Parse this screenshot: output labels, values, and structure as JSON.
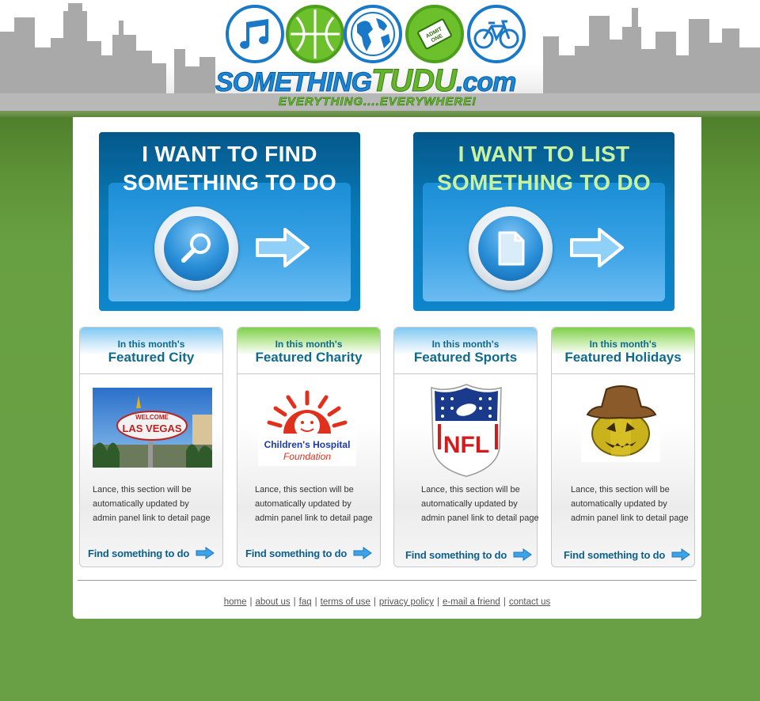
{
  "site": {
    "logo_part1": "SOMETHING",
    "logo_part2": "TUDU",
    "logo_part3": ".com",
    "tagline": "EVERYTHING....EVERYWHERE!"
  },
  "header_icons": [
    "music-icon",
    "basketball-icon",
    "globe-icon",
    "ticket-icon",
    "bicycle-icon"
  ],
  "find_panel": {
    "line1": "I WANT TO FIND",
    "line2": "SOMETHING TO DO",
    "icon": "magnifier-icon"
  },
  "list_panel": {
    "line1": "I WANT TO LIST",
    "line2": "SOMETHING TO DO",
    "icon": "document-icon"
  },
  "featured": [
    {
      "small": "In this month's",
      "title": "Featured City",
      "desc": "Lance, this section will be automatically updated by admin panel link to detail page",
      "link": "Find something to do",
      "image": "Las Vegas welcome sign",
      "image_text": "LAS VEGAS"
    },
    {
      "small": "In this month's",
      "title": "Featured Charity",
      "desc": "Lance, this section will be automatically updated by admin panel link to detail page",
      "link": "Find something to do",
      "image": "BC Children's Hospital Foundation logo",
      "image_text": "Children's Hospital",
      "image_subtext": "Foundation"
    },
    {
      "small": "In this month's",
      "title": "Featured Sports",
      "desc": "Lance, this section will be automatically updated by admin panel link to detail page",
      "link": "Find something to do",
      "image": "NFL shield logo",
      "image_text": "NFL"
    },
    {
      "small": "In this month's",
      "title": "Featured Holidays",
      "desc": "Lance, this section will be automatically updated by admin panel link to detail page",
      "link": "Find something to do",
      "image": "jack-o-lantern pumpkin"
    }
  ],
  "footer_links": [
    "home",
    "about us",
    "faq",
    "terms of use",
    "privacy policy",
    "e-mail a friend",
    "contact us"
  ],
  "colors": {
    "page_green": "#6aa045",
    "panel_blue": "#0a7ab8",
    "title_teal": "#0f6a8e",
    "logo_blue": "#1a86d6",
    "logo_green": "#63b52b"
  }
}
